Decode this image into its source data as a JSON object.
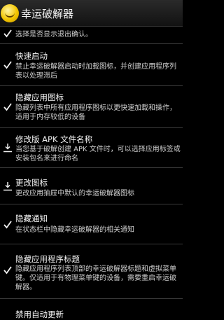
{
  "header": {
    "title": "幸运破解器",
    "icon": "smiley-icon"
  },
  "settings": {
    "items": [
      {
        "title": "",
        "summary": "选择是否显示退出确认。",
        "icon": "check-icon"
      },
      {
        "title": "快速启动",
        "summary": "禁止幸运破解器启动时加载图标，并创建应用程序列表以处理滞后",
        "icon": "check-icon"
      },
      {
        "title": "隐藏应用图标",
        "summary": "隐藏列表中所有应用程序图标以更快速加载和操作，适用于内存较低的设备",
        "icon": "check-icon"
      },
      {
        "title": "修改版 APK 文件名称",
        "summary": "当您基于破解创建 APK 文件时，可以选择应用标签或安装包名来进行命名",
        "icon": "download-icon"
      },
      {
        "title": "更改图标",
        "summary": "更改应用抽屉中默认的幸运破解器图标",
        "icon": "download-icon"
      },
      {
        "title": "隐藏通知",
        "summary": "在状态栏中隐藏幸运破解器的相关通知",
        "icon": "check-icon"
      },
      {
        "title": "隐藏应用程序标题",
        "summary": "隐藏应用程序列表顶部的幸运破解器标题和虚拟菜单键。仅适用于有物理菜单键的设备，需要重启幸运破解器。",
        "icon": "check-icon"
      },
      {
        "title": "禁用自动更新",
        "summary": "",
        "icon": "check-icon"
      }
    ]
  }
}
